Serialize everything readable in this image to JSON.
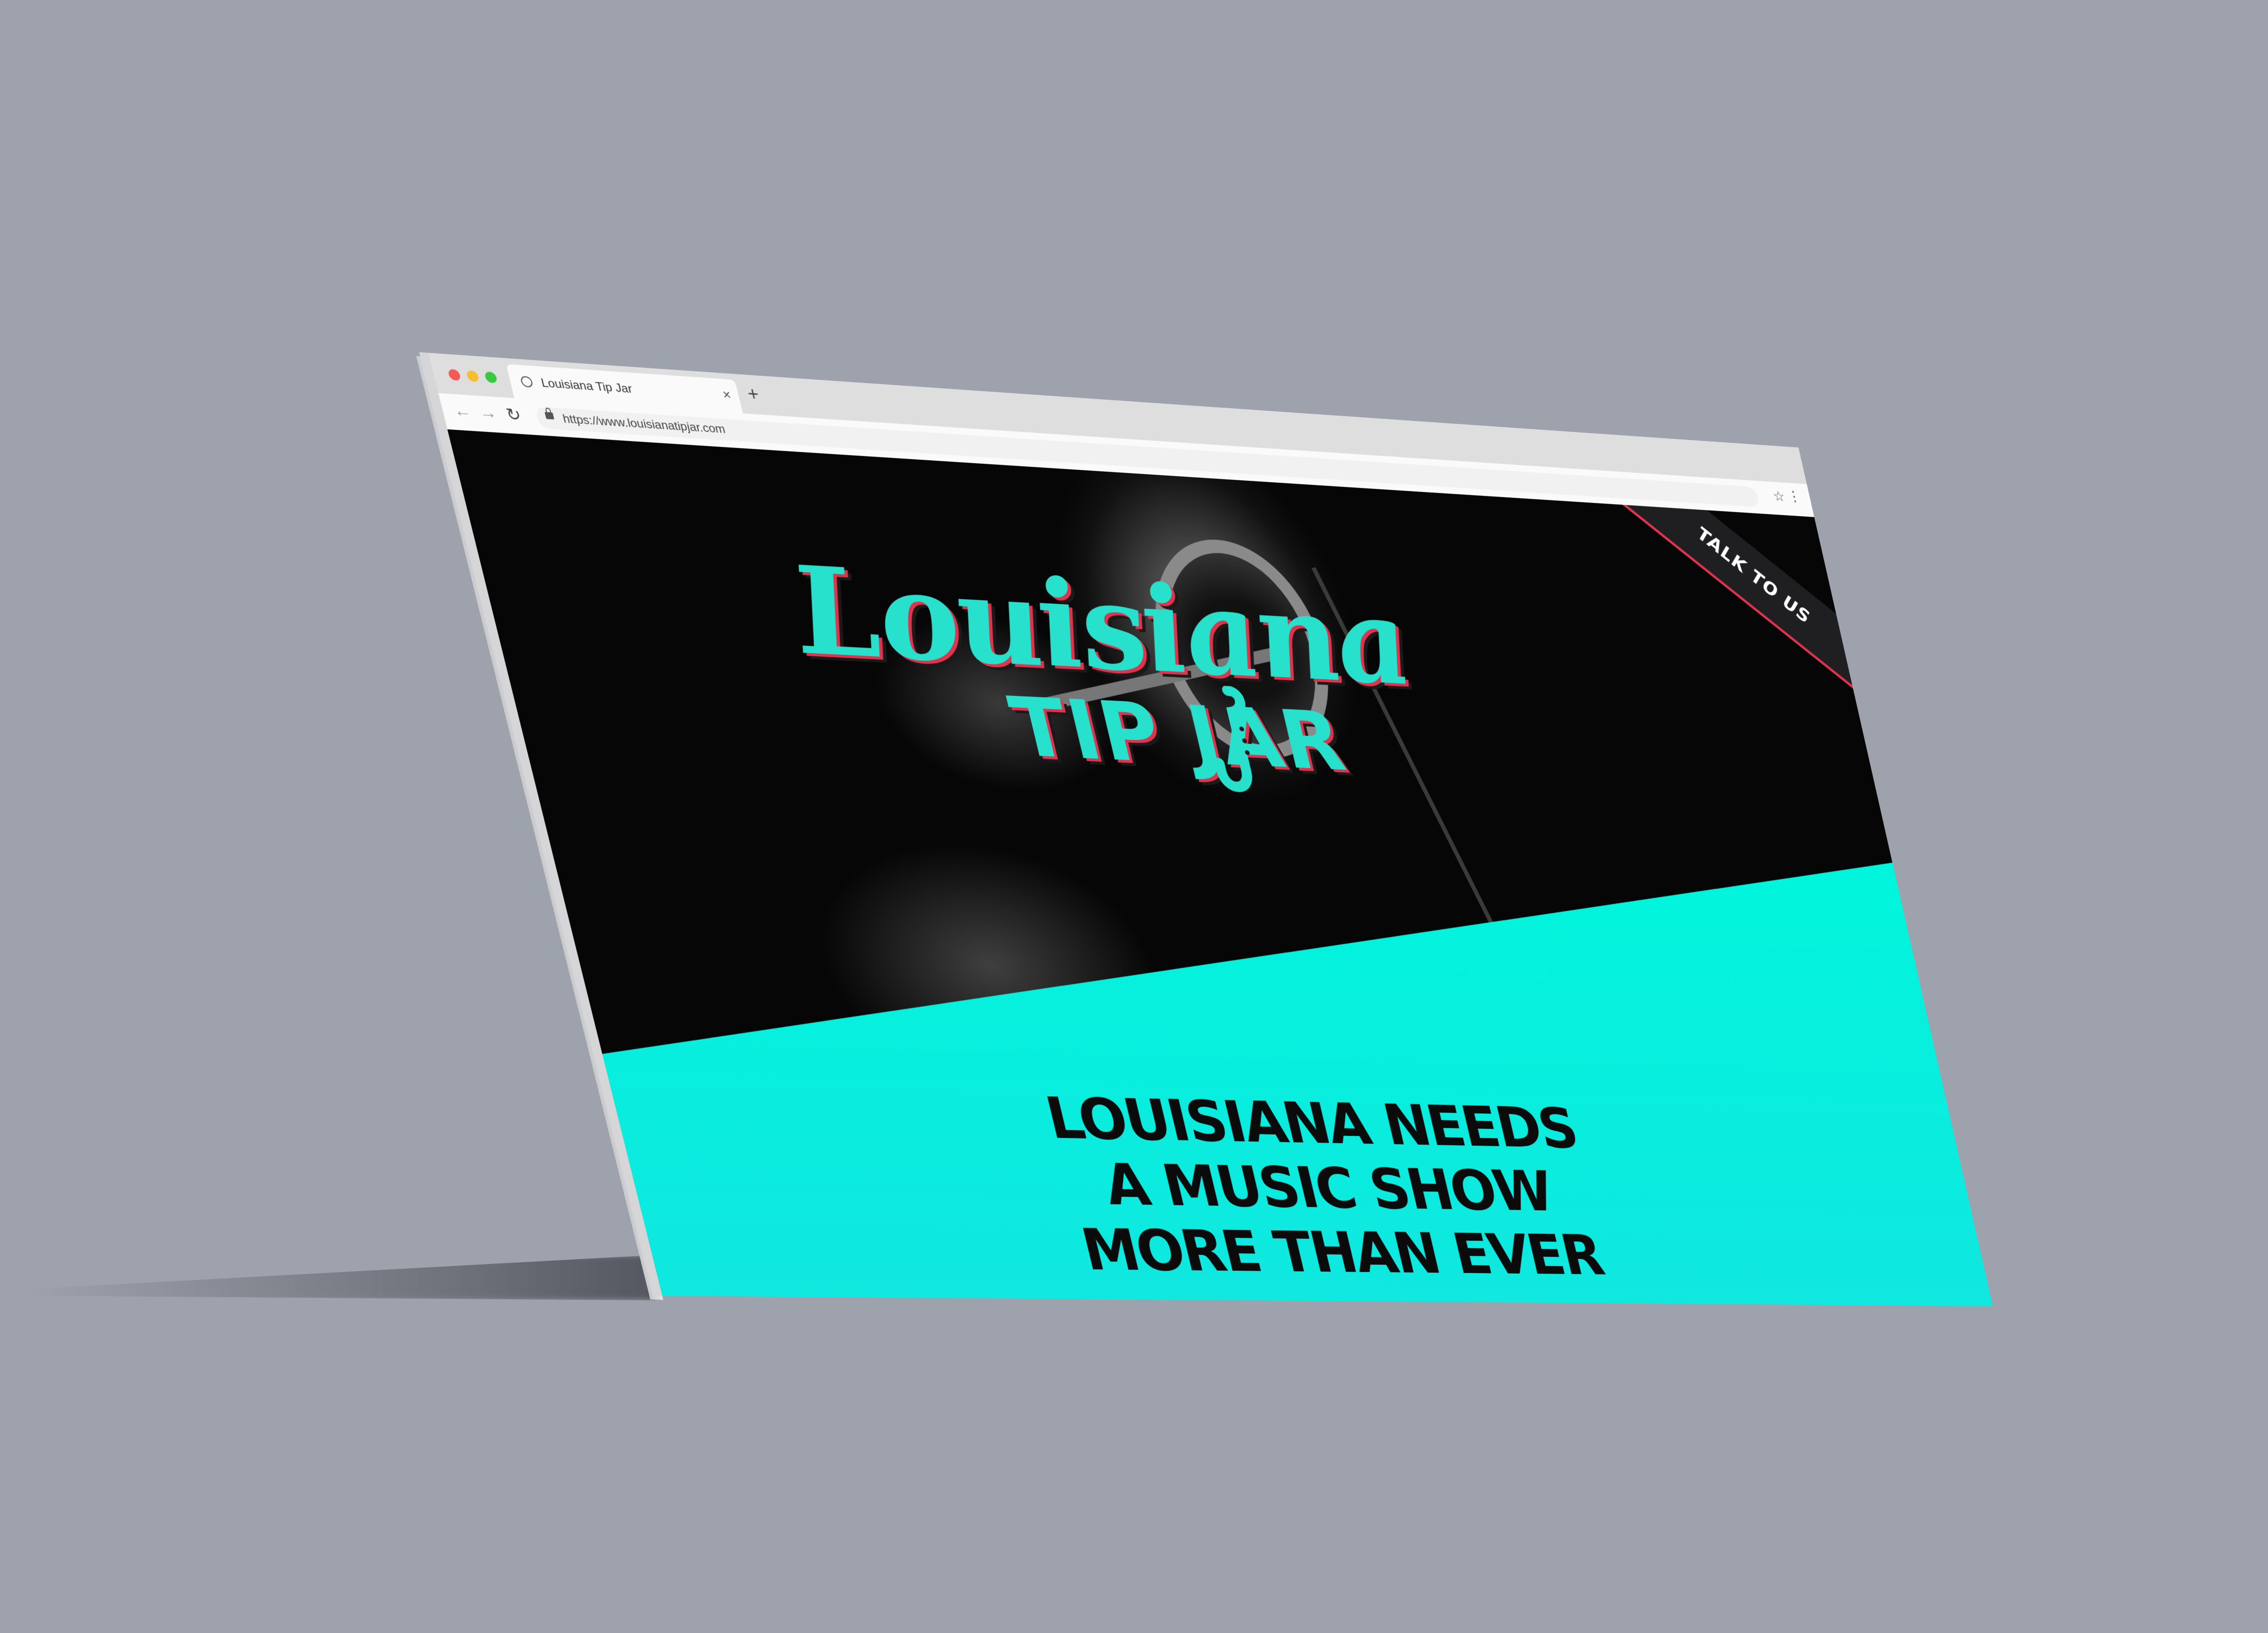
{
  "browser": {
    "tab_title": "Louisiana Tip Jar",
    "tab_close": "×",
    "new_tab": "+",
    "url": "https://www.louisianatipjar.com",
    "icons": {
      "back": "back-arrow-icon",
      "forward": "forward-arrow-icon",
      "reload": "reload-icon",
      "lock": "lock-icon",
      "star": "star-icon",
      "menu": "kebab-menu-icon"
    }
  },
  "hero": {
    "logo_line1": "Louisiana",
    "logo_line2": "TIP JAR",
    "corner_link": "TALK TO US"
  },
  "main": {
    "headline_line1": "LOUISIANA NEEDS",
    "headline_line2": "A MUSIC SHOW",
    "headline_line3": "MORE THAN EVER"
  },
  "colors": {
    "accent": "#00f5dc",
    "logo_red": "#e0344d",
    "background": "#9ea2ac"
  }
}
